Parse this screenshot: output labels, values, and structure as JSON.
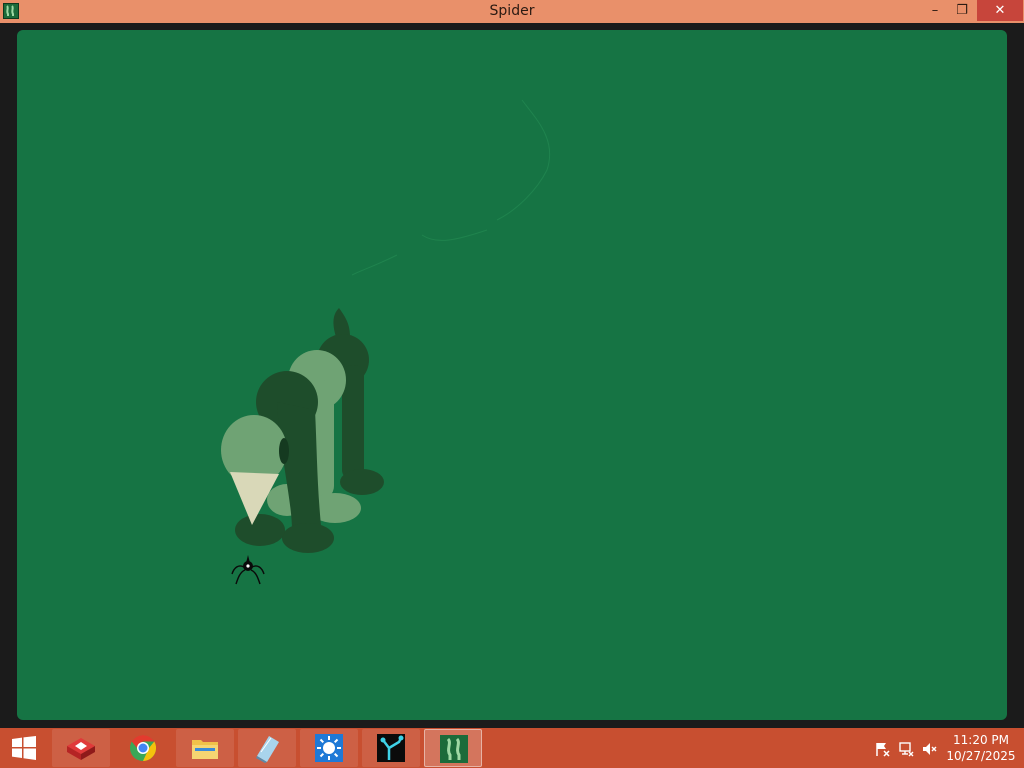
{
  "window": {
    "title": "Spider",
    "controls": {
      "minimize": "–",
      "restore": "❐",
      "close": "✕"
    },
    "titlebar_color": "#e9906a"
  },
  "scene": {
    "background_color": "#167444",
    "player": "spider-icon",
    "creature": "green-elephant-creature"
  },
  "taskbar": {
    "color": "#c84f30",
    "start_icon": "windows-logo-icon",
    "apps": [
      {
        "name": "red-isometric-app-icon"
      },
      {
        "name": "chrome-browser-icon"
      },
      {
        "name": "file-explorer-icon"
      },
      {
        "name": "notepad-app-icon"
      },
      {
        "name": "blue-sun-app-icon"
      },
      {
        "name": "cyan-branch-app-icon"
      },
      {
        "name": "spider-app-icon"
      }
    ],
    "tray": {
      "icons": [
        "action-center-flag-icon",
        "network-icon",
        "volume-muted-icon"
      ],
      "time": "11:20 PM",
      "date": "10/27/2025"
    }
  }
}
